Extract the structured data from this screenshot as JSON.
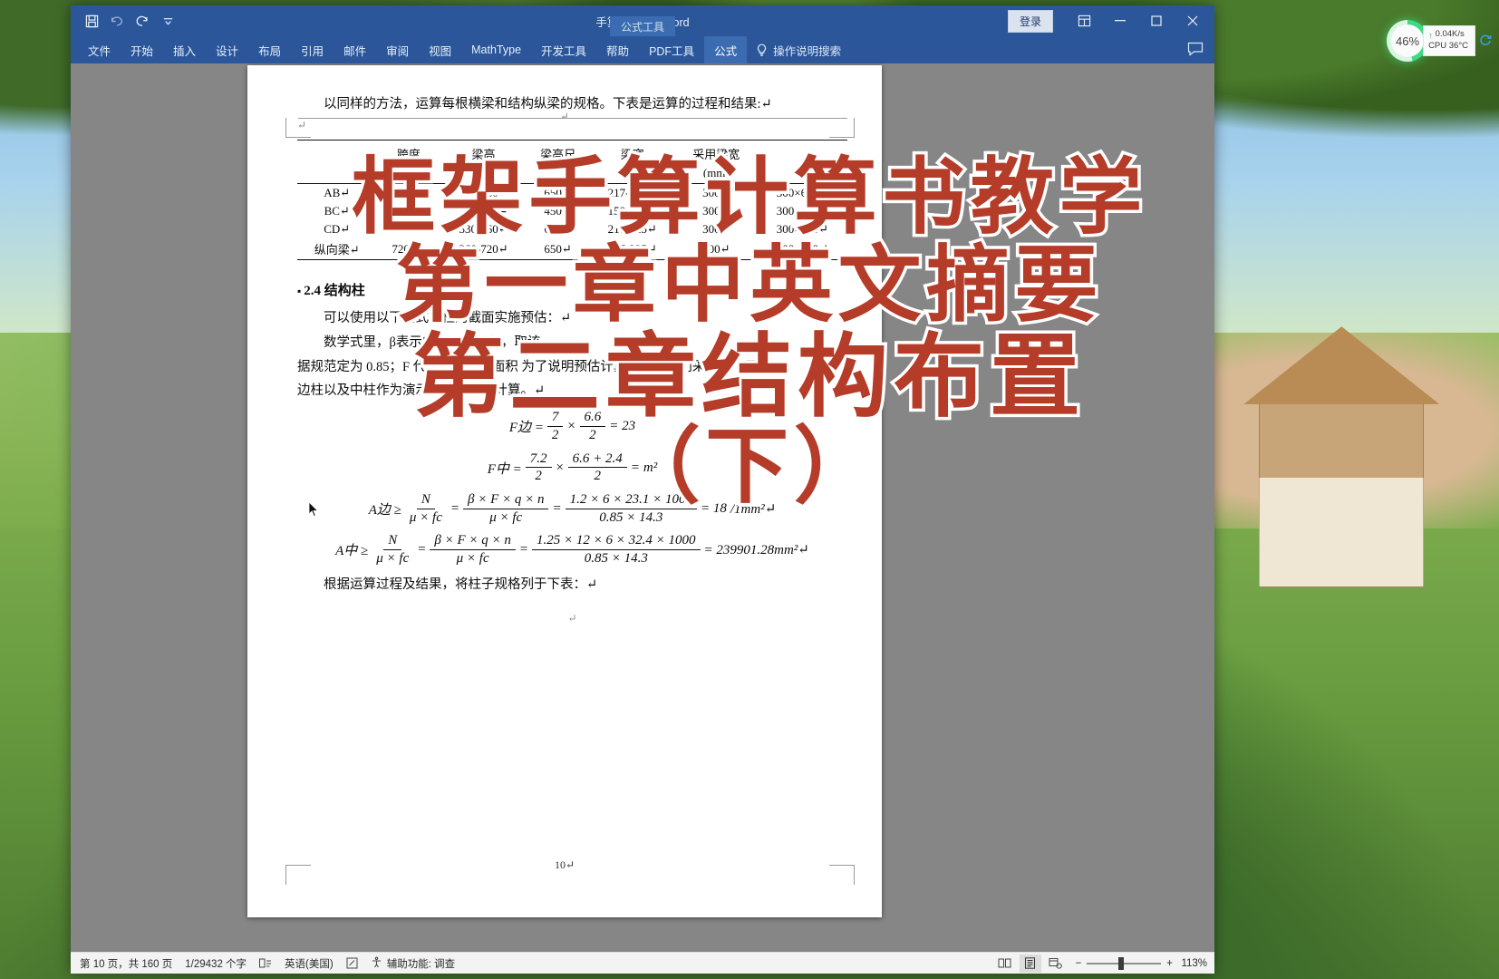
{
  "window": {
    "title": "手算计算书 - Word",
    "quick_access": [
      "save-icon",
      "undo-icon",
      "redo-icon",
      "customize-qat-icon"
    ],
    "signin_label": "登录",
    "ribbon_display_icon": "ribbon-display-options-icon",
    "minimize_icon": "minimize-icon",
    "restore_icon": "restore-icon",
    "close_icon": "close-icon",
    "comment_icon": "comment-icon"
  },
  "ribbon": {
    "contextual_group": "公式工具",
    "tabs": [
      {
        "label": "文件",
        "active": false
      },
      {
        "label": "开始",
        "active": false
      },
      {
        "label": "插入",
        "active": false
      },
      {
        "label": "设计",
        "active": false
      },
      {
        "label": "布局",
        "active": false
      },
      {
        "label": "引用",
        "active": false
      },
      {
        "label": "邮件",
        "active": false
      },
      {
        "label": "审阅",
        "active": false
      },
      {
        "label": "视图",
        "active": false
      },
      {
        "label": "MathType",
        "active": false
      },
      {
        "label": "开发工具",
        "active": false
      },
      {
        "label": "帮助",
        "active": false
      },
      {
        "label": "PDF工具",
        "active": false
      },
      {
        "label": "公式",
        "active": true
      }
    ],
    "tell_me": "操作说明搜索",
    "tell_me_icon": "lightbulb-icon"
  },
  "document": {
    "header_mark": "↵",
    "intro_paragraph": "以同样的方法，运算每根横梁和结构纵梁的规格。下表是运算的过程和结果:↵",
    "blank_mark": "↵",
    "table": {
      "headers_top": [
        "",
        "跨度",
        "梁高",
        "梁高尺",
        "梁宽",
        "采用梁宽"
      ],
      "headers_sub": [
        "",
        "(mm)↵",
        "",
        "",
        "",
        "(mm)"
      ],
      "columns": [
        "",
        "跨度↵(mm",
        "梁高",
        "采用梁高↵",
        "梁宽",
        "采用梁宽↵(mm"
      ],
      "rows": [
        {
          "name": "AB↵",
          "span": "6600↵",
          "h_calc": "330-660↵",
          "h_used": "650↵",
          "b_calc": "217-325↵",
          "b_used": "300↵",
          "size": "300×650↵"
        },
        {
          "name": "BC↵",
          "span": "2400↵",
          "h_calc": "200-240↵",
          "h_used": "450↵",
          "b_calc": "150-225↵",
          "b_used": "300↵",
          "size": "300×450↵"
        },
        {
          "name": "CD↵",
          "span": "6600↵",
          "h_calc": "330-660↵",
          "h_used": "650↵",
          "b_calc": "217-325↵",
          "b_used": "300↵",
          "size": "300×650↵"
        },
        {
          "name": "纵向梁↵",
          "span": "7200↵",
          "h_calc": "360-720↵",
          "h_used": "650↵",
          "b_calc": "217-325↵",
          "b_used": "300↵",
          "size": "300×650↵"
        }
      ]
    },
    "section_heading": "2.4 结构柱",
    "para_formula_intro": "可以使用以下公式对柱的截面实施预估：↵",
    "para_note_1": "数学式里，β表示内力增大系数，取该",
    "para_note_2": "据规范定为 0.85；F 代表预估受压面积      为了说明预估计算过程，我们采用第一层",
    "para_note_3": "边柱以及中柱作为演示，请看下面计算。↵",
    "formulas": {
      "f_bian": {
        "lhs": "F边 =",
        "n1": "7",
        "d1": "2",
        "times": "×",
        "n2": "6.6",
        "d2": "2",
        "result": "= 23"
      },
      "f_zhong": {
        "lhs": "F中 =",
        "n1": "7.2",
        "d1": "2",
        "times": "×",
        "n2": "6.6 + 2.4",
        "d2": "2",
        "result": "= ",
        "unit": "m²"
      },
      "a_bian": {
        "lhs": "A边 ≥",
        "f1n": "N",
        "f1d": "μ × fc",
        "eq1": "=",
        "f2n": "β × F × q × n",
        "f2d": "μ × fc",
        "eq2": "=",
        "f3n": "1.2 × 6 × 23.1 × 1000",
        "f3d": "0.85 × 14.3",
        "result": "= 18",
        "unit": "/1mm²↵"
      },
      "a_zhong": {
        "lhs": "A中 ≥",
        "f1n": "N",
        "f1d": "μ × fc",
        "eq1": "=",
        "f2n": "β × F × q × n",
        "f2d": "μ × fc",
        "eq2": "=",
        "f3n": "1.25 × 12 × 6 × 32.4 × 1000",
        "f3d": "0.85 × 14.3",
        "result": "= 239901.28mm²↵"
      }
    },
    "para_closing": "根据运算过程及结果，将柱子规格列于下表：↵",
    "trailing_mark": "↵",
    "page_number": "10↵"
  },
  "statusbar": {
    "page_info": "第 10 页，共 160 页",
    "word_count": "1/29432 个字",
    "spellcheck_icon": "spellcheck-icon",
    "language": "英语(美国)",
    "track_changes_icon": "track-changes-icon",
    "accessibility_icon": "accessibility-icon",
    "accessibility": "辅助功能: 调查",
    "view_read_icon": "read-mode-icon",
    "view_print_icon": "print-layout-icon",
    "view_web_icon": "web-layout-icon",
    "zoom_out": "−",
    "zoom_in": "+",
    "zoom_level": "113%"
  },
  "overlay": {
    "line1": "框架手算计算书教学",
    "line2": "第一章中英文摘要",
    "line3": "第二章结构布置",
    "line4": "（下）",
    "color": "#b43c28"
  },
  "tray": {
    "cpu_percent": "46%",
    "net_speed": "0.04K/s",
    "cpu_temp": "CPU 36°C",
    "up_arrow": "↑",
    "refresh_icon": "refresh-icon"
  }
}
